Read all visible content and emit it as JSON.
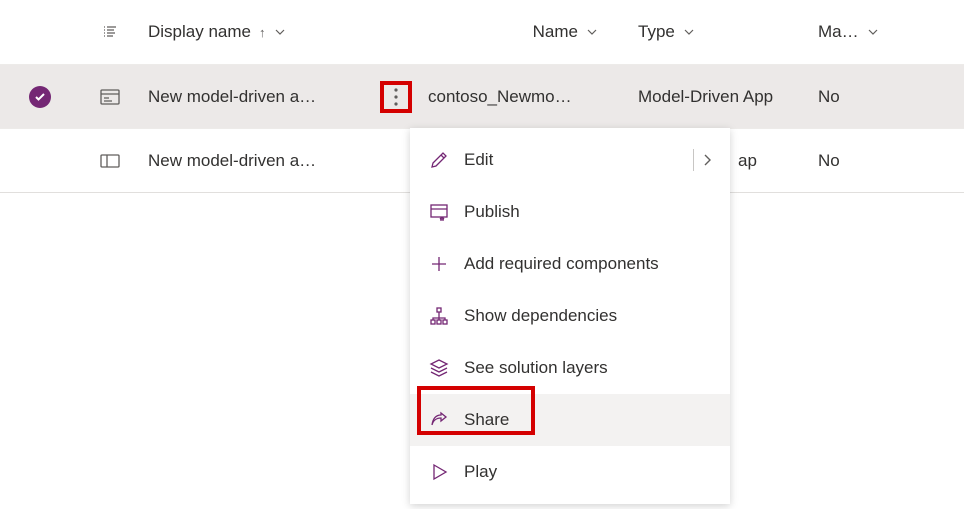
{
  "columns": {
    "display_name": "Display name",
    "name": "Name",
    "type": "Type",
    "managed": "Ma…"
  },
  "rows": [
    {
      "selected": true,
      "icon": "app-card-icon",
      "display_name": "New model-driven a…",
      "name": "contoso_Newmo…",
      "type": "Model-Driven App",
      "managed": "No"
    },
    {
      "selected": false,
      "icon": "app-icon",
      "display_name": "New model-driven a…",
      "name": "",
      "type": "ap",
      "managed": "No"
    }
  ],
  "menu": {
    "edit": "Edit",
    "publish": "Publish",
    "add_components": "Add required components",
    "show_dependencies": "Show dependencies",
    "see_layers": "See solution layers",
    "share": "Share",
    "play": "Play"
  }
}
